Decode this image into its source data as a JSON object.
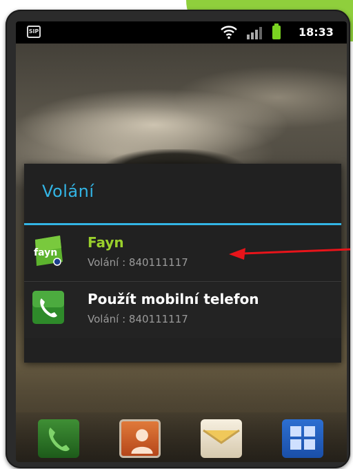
{
  "status_bar": {
    "time": "18:33",
    "notification_icon": "voip-icon",
    "wifi_icon": "wifi-icon",
    "signal_icon": "signal-icon",
    "battery_icon": "battery-icon",
    "notification_badge": "SIP"
  },
  "dialog": {
    "title": "Volání",
    "options": [
      {
        "app": "Fayn",
        "subtitle": "Volání : 840111117",
        "icon": "fayn-logo-icon",
        "icon_text": "fayn"
      },
      {
        "app": "Použít mobilní telefon",
        "subtitle": "Volání : 840111117",
        "icon": "phone-icon"
      }
    ]
  },
  "annotation": {
    "icon": "red-arrow-icon",
    "color": "#e8141a"
  },
  "dock": [
    {
      "icon": "phone-icon"
    },
    {
      "icon": "contacts-icon"
    },
    {
      "icon": "messages-icon"
    },
    {
      "icon": "app-grid-icon"
    }
  ],
  "colors": {
    "accent": "#33b5e5",
    "fayn_green": "#9ad02c",
    "dialog_bg": "#212121",
    "tab_green": "#8fcf3c"
  }
}
